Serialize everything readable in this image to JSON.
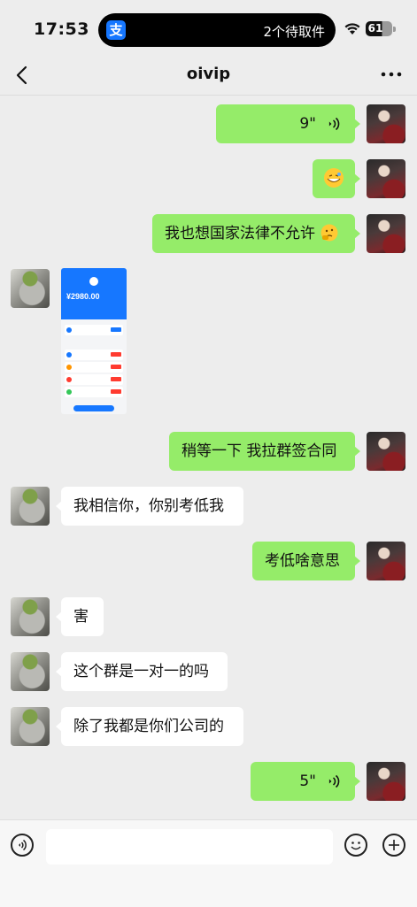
{
  "status_bar": {
    "time": "17:53",
    "island_app_glyph": "支",
    "island_text": "2个待取件",
    "battery": "61"
  },
  "nav": {
    "title": "oivip",
    "back_icon": "chevron-left-icon",
    "more_icon": "more-dots-icon"
  },
  "messages": [
    {
      "sender": "me",
      "type": "voice",
      "text": "9\""
    },
    {
      "sender": "me",
      "type": "emoji",
      "emoji": "grimace-emoji"
    },
    {
      "sender": "me",
      "type": "text",
      "text": "我也想国家法律不允许"
    },
    {
      "sender": "other",
      "type": "image",
      "image": {
        "amount": "¥2980.00",
        "rows": 4
      }
    },
    {
      "sender": "me",
      "type": "text",
      "text": "稍等一下 我拉群签合同"
    },
    {
      "sender": "other",
      "type": "text",
      "text": "我相信你，你别考低我"
    },
    {
      "sender": "me",
      "type": "text",
      "text": "考低啥意思"
    },
    {
      "sender": "other",
      "type": "text",
      "text": "害"
    },
    {
      "sender": "other",
      "type": "text",
      "text": "这个群是一对一的吗"
    },
    {
      "sender": "other",
      "type": "text",
      "text": "除了我都是你们公司的"
    },
    {
      "sender": "me",
      "type": "voice",
      "text": "5\""
    }
  ],
  "input_bar": {
    "voice_icon": "voice-toggle-icon",
    "emoji_icon": "emoji-icon",
    "plus_icon": "plus-icon",
    "placeholder": ""
  },
  "colors": {
    "my_bubble": "#95ec69",
    "other_bubble": "#ffffff",
    "background": "#ededed",
    "alipay_blue": "#1677ff"
  }
}
